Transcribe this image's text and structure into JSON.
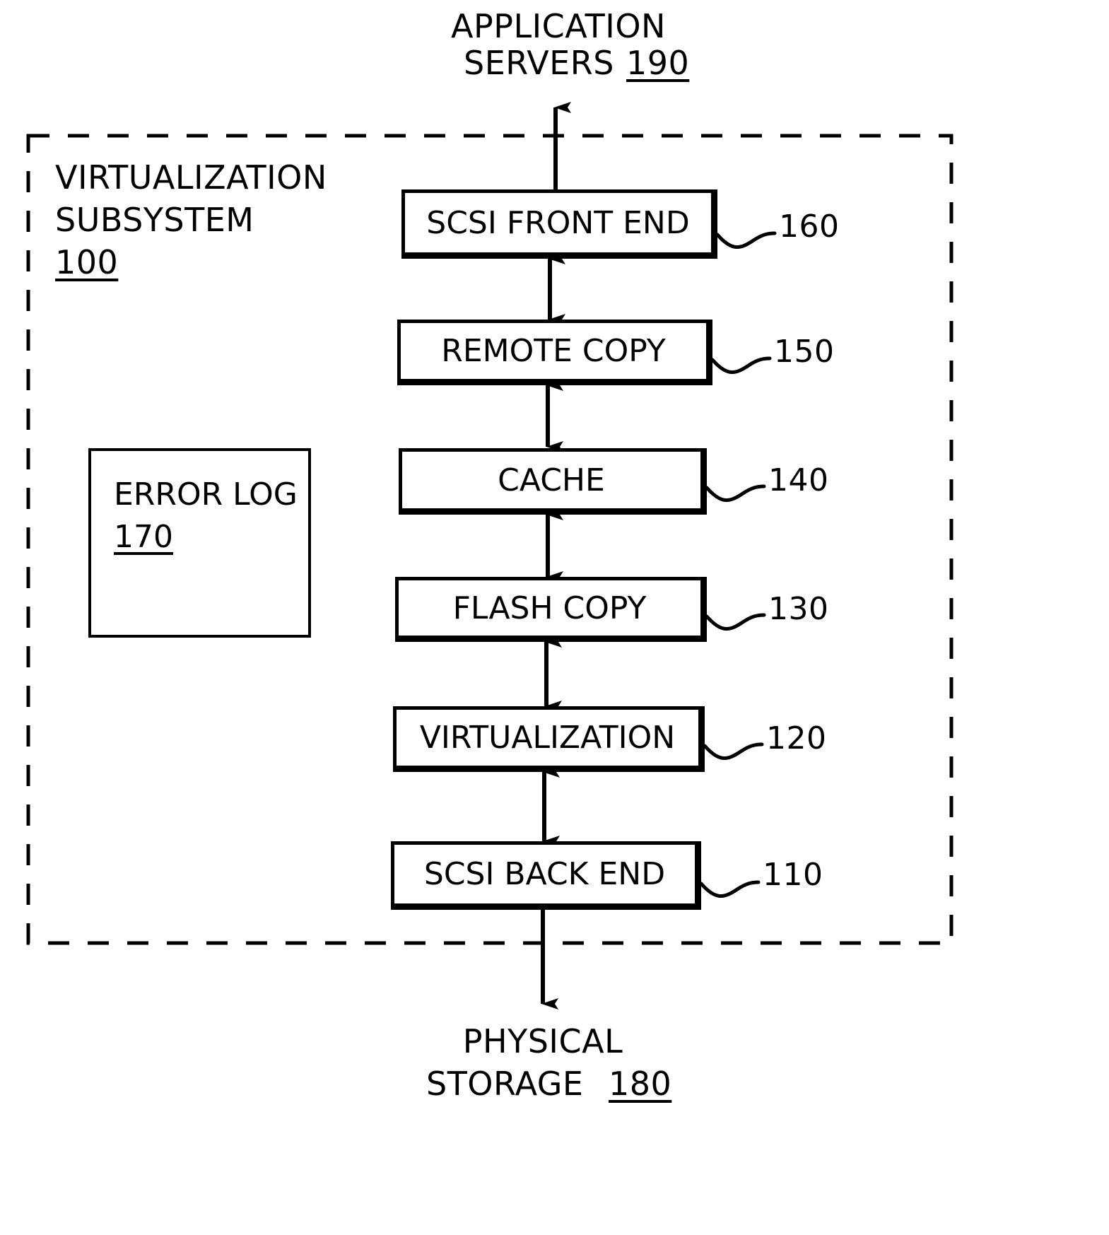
{
  "figure": {
    "title": "Virtualization subsystem block diagram",
    "line_color": "#000000",
    "background": "#ffffff"
  },
  "top_label": {
    "line1": "APPLICATION",
    "line2": "SERVERS",
    "ref": "190"
  },
  "bottom_label": {
    "line1": "PHYSICAL",
    "line2": "STORAGE",
    "ref": "180"
  },
  "boundary": {
    "name_line1": "VIRTUALIZATION",
    "name_line2": "SUBSYSTEM",
    "ref": "100",
    "style": "dashed"
  },
  "error_log": {
    "label": "ERROR LOG",
    "ref": "170"
  },
  "stack": [
    {
      "label": "SCSI FRONT END",
      "ref": "160"
    },
    {
      "label": "REMOTE COPY",
      "ref": "150"
    },
    {
      "label": "CACHE",
      "ref": "140"
    },
    {
      "label": "FLASH COPY",
      "ref": "130"
    },
    {
      "label": "VIRTUALIZATION",
      "ref": "120"
    },
    {
      "label": "SCSI BACK END",
      "ref": "110"
    }
  ],
  "connectors": {
    "top_arrow": "single-arrow-up-to-application-servers",
    "bottom_arrow": "single-arrow-down-to-physical-storage",
    "between_boxes": "double-headed-vertical-arrow"
  }
}
